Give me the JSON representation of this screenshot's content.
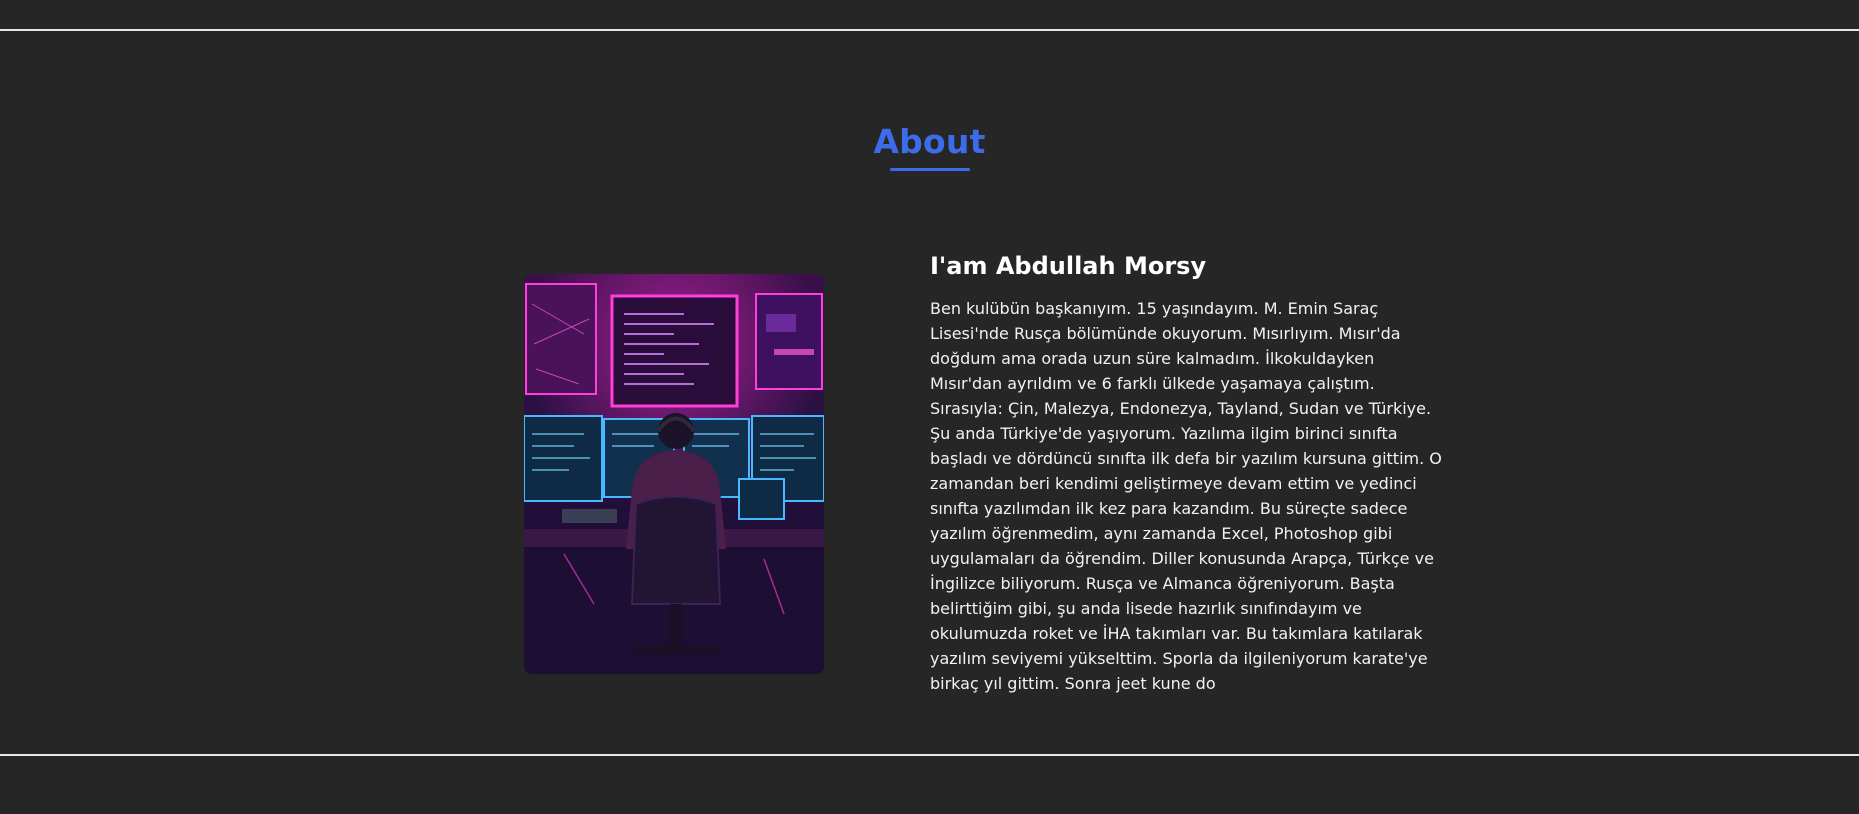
{
  "about": {
    "title": "About",
    "heading": "I'am Abdullah Morsy",
    "bio": "Ben kulübün başkanıyım. 15 yaşındayım. M. Emin Saraç Lisesi'nde Rusça bölümünde okuyorum. Mısırlıyım. Mısır'da doğdum ama orada uzun süre kalmadım. İlkokuldayken Mısır'dan ayrıldım ve 6 farklı ülkede yaşamaya çalıştım. Sırasıyla: Çin, Malezya, Endonezya, Tayland, Sudan ve Türkiye. Şu anda Türkiye'de yaşıyorum. Yazılıma ilgim birinci sınıfta başladı ve dördüncü sınıfta ilk defa bir yazılım kursuna gittim. O zamandan beri kendimi geliştirmeye devam ettim ve yedinci sınıfta yazılımdan ilk kez para kazandım. Bu süreçte sadece yazılım öğrenmedim, aynı zamanda Excel, Photoshop gibi uygulamaları da öğrendim. Diller konusunda Arapça, Türkçe ve İngilizce biliyorum. Rusça ve Almanca öğreniyorum. Başta belirttiğim gibi, şu anda lisede hazırlık sınıfındayım ve okulumuzda roket ve İHA takımları var. Bu takımlara katılarak yazılım seviyemi yükselttim. Sporla da ilgileniyorum karate'ye birkaç yıl gittim. Sonra jeet kune do"
  },
  "colors": {
    "background": "#262626",
    "accent": "#3d6ce8",
    "divider": "#e6e6e6"
  }
}
